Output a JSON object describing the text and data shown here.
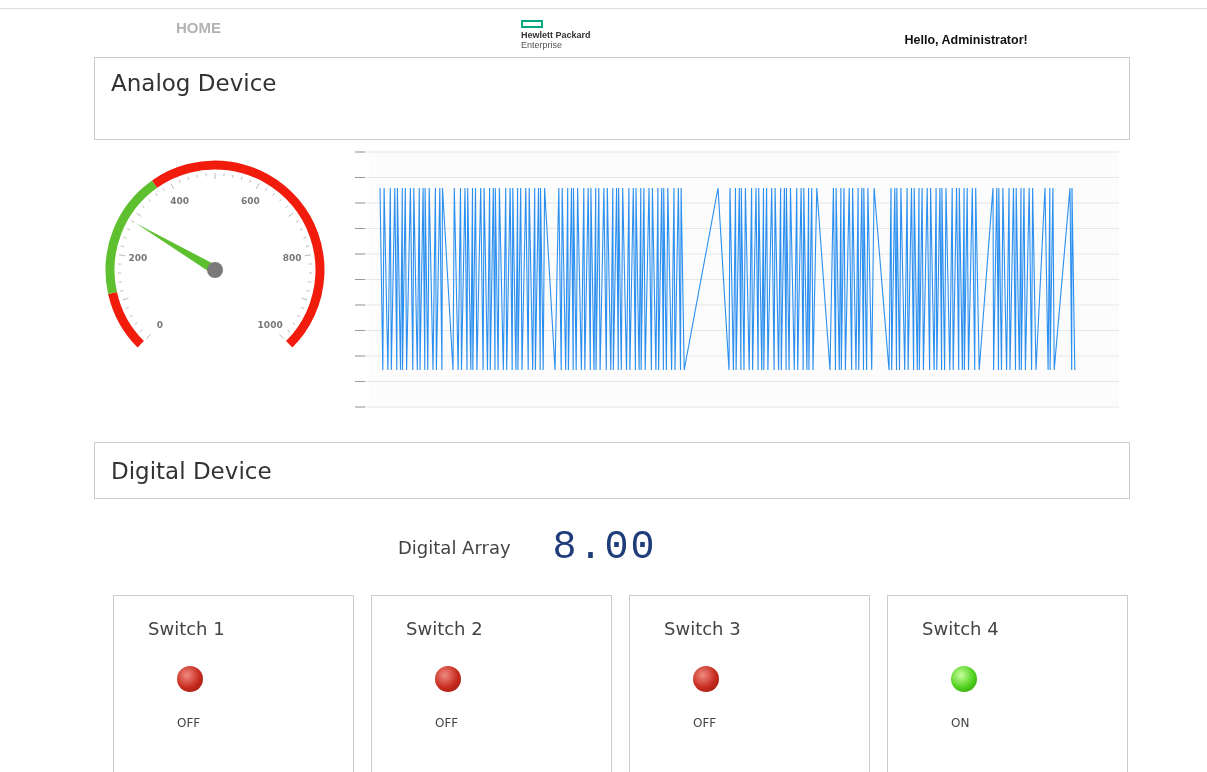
{
  "header": {
    "nav": "HOME",
    "logo": {
      "line_1": "Hewlett Packard",
      "line_2": "Enterprise"
    },
    "greeting": "Hello, Administrator!"
  },
  "analog": {
    "title": "Analog Device",
    "gauge": {
      "labels": [
        "0",
        "200",
        "400",
        "600",
        "800",
        "1000"
      ]
    }
  },
  "digital": {
    "title": "Digital Device",
    "array_label": "Digital Array",
    "array_value": "8.00",
    "switches": [
      {
        "name": "Switch 1",
        "on": false,
        "status": "OFF"
      },
      {
        "name": "Switch 2",
        "on": false,
        "status": "OFF"
      },
      {
        "name": "Switch 3",
        "on": false,
        "status": "OFF"
      },
      {
        "name": "Switch 4",
        "on": true,
        "status": "ON"
      }
    ]
  }
}
